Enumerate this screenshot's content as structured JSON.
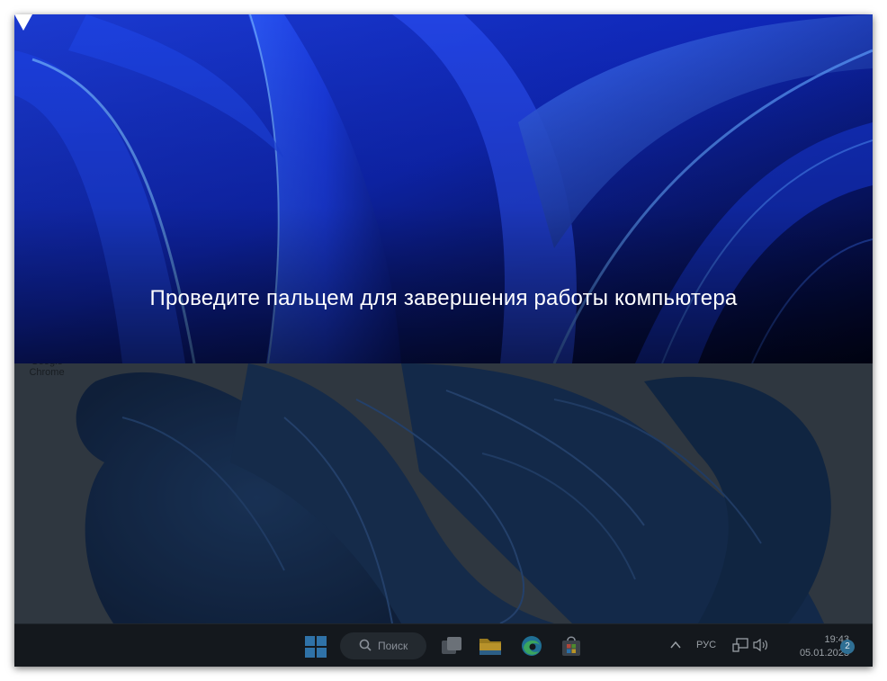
{
  "shutdown_slide": {
    "instruction": "Проведите пальцем для завершения работы компьютера",
    "arrow_icon": "triangle-down-icon"
  },
  "desktop": {
    "icons": [
      {
        "label": "Google Chrome",
        "icon": "chrome-icon"
      }
    ]
  },
  "taskbar": {
    "search_label": "Поиск",
    "pinned": [
      {
        "name": "start",
        "icon": "windows-logo-icon"
      },
      {
        "name": "task-view",
        "icon": "task-view-icon"
      },
      {
        "name": "file-explorer",
        "icon": "folder-icon"
      },
      {
        "name": "edge",
        "icon": "edge-icon"
      },
      {
        "name": "store",
        "icon": "store-icon"
      }
    ],
    "tray": {
      "language": "РУС",
      "time": "19:43",
      "date": "05.01.2023",
      "notification_count": "2"
    }
  },
  "colors": {
    "panel_blue": "#1232c8",
    "panel_dark": "#020a3a",
    "taskbar": "#14181d",
    "accent": "#2f6f94"
  }
}
